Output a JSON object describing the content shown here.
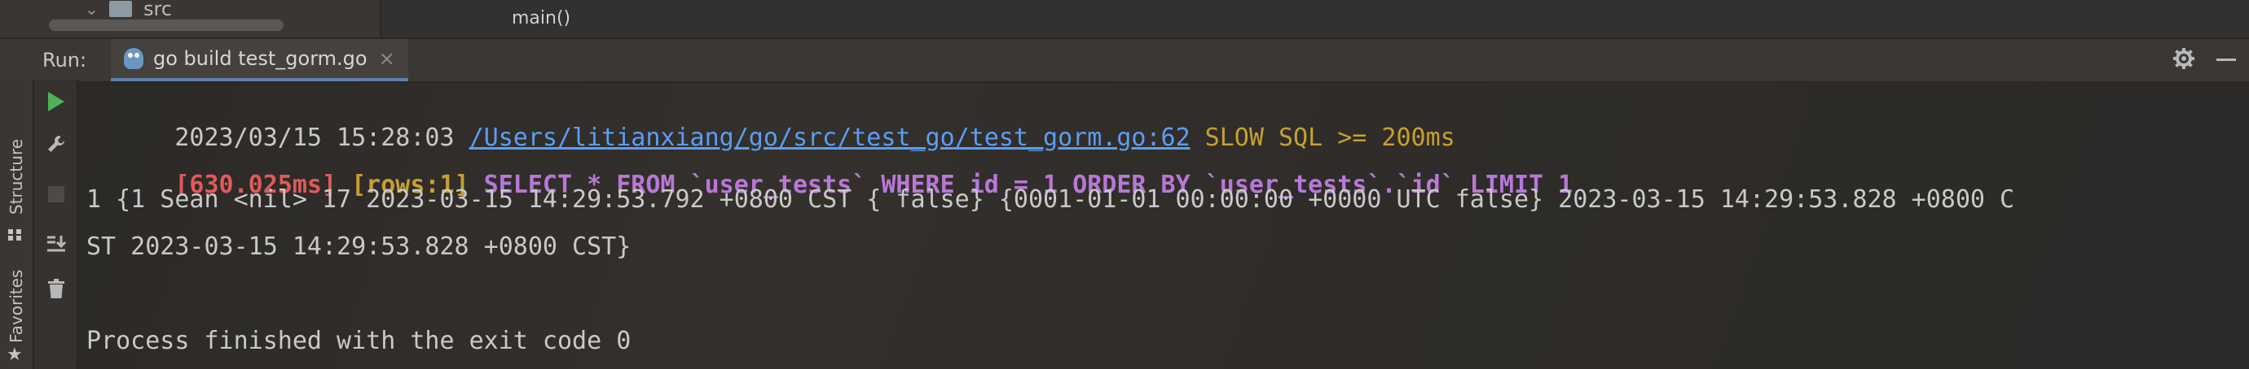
{
  "top": {
    "tree_item": "src",
    "breadcrumb": "main()"
  },
  "run": {
    "label": "Run:",
    "tab_title": "go build test_gorm.go",
    "tab_close": "×"
  },
  "side": {
    "structure": "Structure",
    "favorites": "Favorites"
  },
  "console": {
    "l1_time": "2023/03/15 15:28:03 ",
    "l1_path": "/Users/litianxiang/go/src/test_go/test_gorm.go:62",
    "l1_slow": " SLOW SQL >= 200ms",
    "l2_ms": "[630.025ms]",
    "l2_rows": " [rows:1]",
    "l2_sql": " SELECT * FROM `user_tests` WHERE id = 1 ORDER BY `user_tests`.`id` LIMIT 1",
    "l3": "1 {1 Sean <nil> 17 2023-03-15 14:29:53.792 +0800 CST { false} {0001-01-01 00:00:00 +0000 UTC false} 2023-03-15 14:29:53.828 +0800 C",
    "l4": "ST 2023-03-15 14:29:53.828 +0800 CST}",
    "l6": "Process finished with the exit code 0"
  },
  "colors": {
    "link": "#5a9ef3",
    "warning": "#c5a12f",
    "error": "#e05a5a",
    "sql": "#b977d8",
    "run_green": "#4fb159"
  },
  "icons": [
    "folder-icon",
    "gopher-icon",
    "gear-icon",
    "minimize-icon",
    "rerun-icon",
    "wrench-icon",
    "stop-icon",
    "scroll-to-end-icon",
    "trash-icon",
    "star-icon"
  ]
}
